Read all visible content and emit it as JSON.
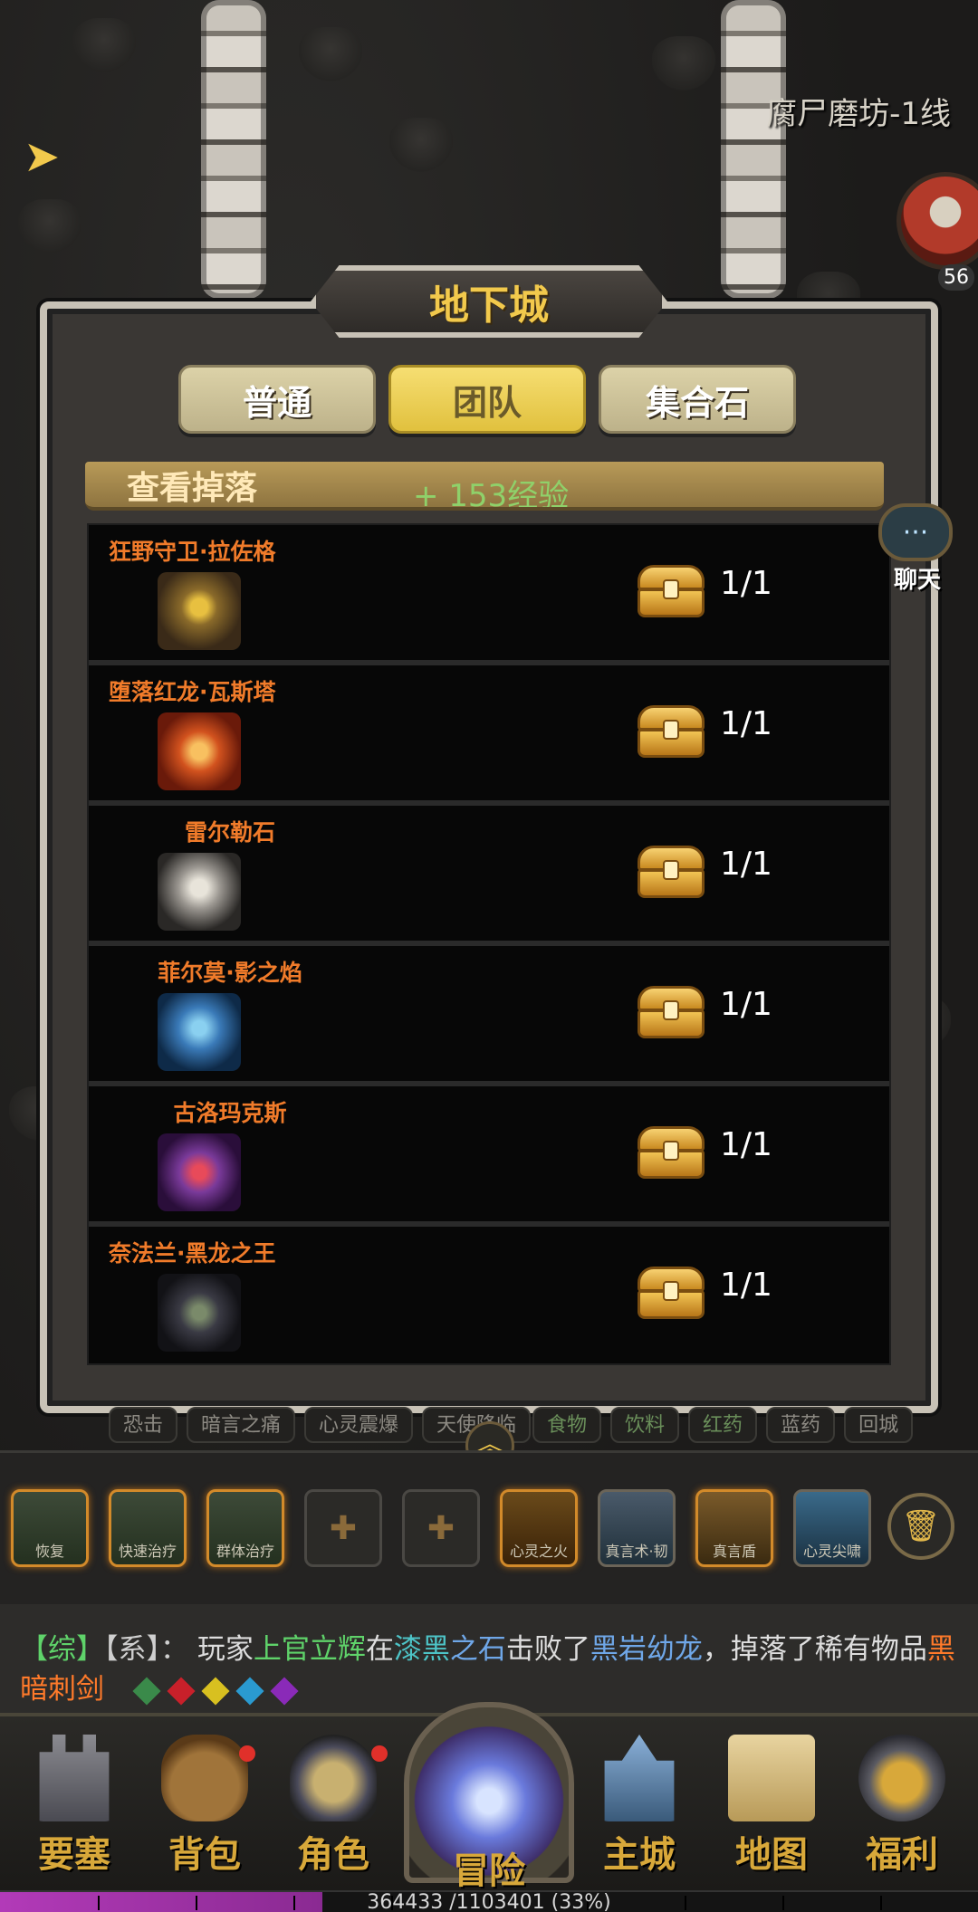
{
  "location": "腐尸磨坊-1线",
  "enemy": {
    "level": "56"
  },
  "dungeon": {
    "title": "地下城",
    "tabs": [
      {
        "label": "普通",
        "active": false
      },
      {
        "label": "团队",
        "active": true
      },
      {
        "label": "集合石",
        "active": false
      }
    ],
    "view_drops_label": "查看掉落",
    "exp_label": "+ 153经验",
    "bosses": [
      {
        "name": "狂野守卫·拉佐格",
        "count": "1/1",
        "icon": "golem-boss-icon",
        "color": "#8a6a2a"
      },
      {
        "name": "堕落红龙·瓦斯塔",
        "count": "1/1",
        "icon": "red-dragon-icon",
        "color": "#d2521e"
      },
      {
        "name": "雷尔勒石",
        "count": "1/1",
        "icon": "stone-golem-icon",
        "color": "#9a9690"
      },
      {
        "name": "菲尔莫·影之焰",
        "count": "1/1",
        "icon": "blue-dragon-icon",
        "color": "#3a7ab8"
      },
      {
        "name": "古洛玛克斯",
        "count": "1/1",
        "icon": "purple-beast-icon",
        "color": "#7a3a9a"
      },
      {
        "name": "奈法兰·黑龙之王",
        "count": "1/1",
        "icon": "black-dragon-icon",
        "color": "#3a3a44"
      }
    ]
  },
  "chat_button": {
    "label": "聊天",
    "icon": "chat-bubble-icon"
  },
  "quick_buttons_left": [
    "恐击",
    "暗言之痛",
    "心灵震爆",
    "天使降临"
  ],
  "quick_buttons_right": [
    "食物",
    "饮料",
    "红药",
    "蓝药",
    "回城"
  ],
  "skills": [
    {
      "label": "恢复",
      "type": "gold"
    },
    {
      "label": "快速治疗",
      "type": "gold"
    },
    {
      "label": "群体治疗",
      "type": "gold"
    },
    {
      "label": "",
      "type": "empty"
    },
    {
      "label": "",
      "type": "empty"
    },
    {
      "label": "心灵之火",
      "type": "normal"
    },
    {
      "label": "真言术·韧",
      "type": "normal"
    },
    {
      "label": "真言盾",
      "type": "normal"
    },
    {
      "label": "心灵尖啸",
      "type": "normal"
    }
  ],
  "chat_message": {
    "channel": "【综】",
    "system": "【系】",
    "sep": "：",
    "prefix": "玩家",
    "player": "上官立辉",
    "mid1": "在",
    "place1": "漆黑",
    "place2": "之石",
    "mid2": "击败了",
    "monster": "黑岩幼龙",
    "mid3": "，掉落了稀有物品",
    "item": "黑暗刺剑"
  },
  "gem_colors": [
    "#3a8a4a",
    "#c8202a",
    "#d8c020",
    "#2a9ad0",
    "#8a2ab8"
  ],
  "nav": [
    {
      "label": "要塞",
      "icon": "fortress-icon"
    },
    {
      "label": "背包",
      "icon": "backpack-icon"
    },
    {
      "label": "角色",
      "icon": "helmet-icon"
    },
    {
      "label": "冒险",
      "icon": "portal-icon"
    },
    {
      "label": "主城",
      "icon": "castle-icon"
    },
    {
      "label": "地图",
      "icon": "scroll-map-icon"
    },
    {
      "label": "福利",
      "icon": "gift-bell-icon"
    }
  ],
  "xp": {
    "text": "364433 /1103401 (33%)",
    "fraction": 0.33
  }
}
